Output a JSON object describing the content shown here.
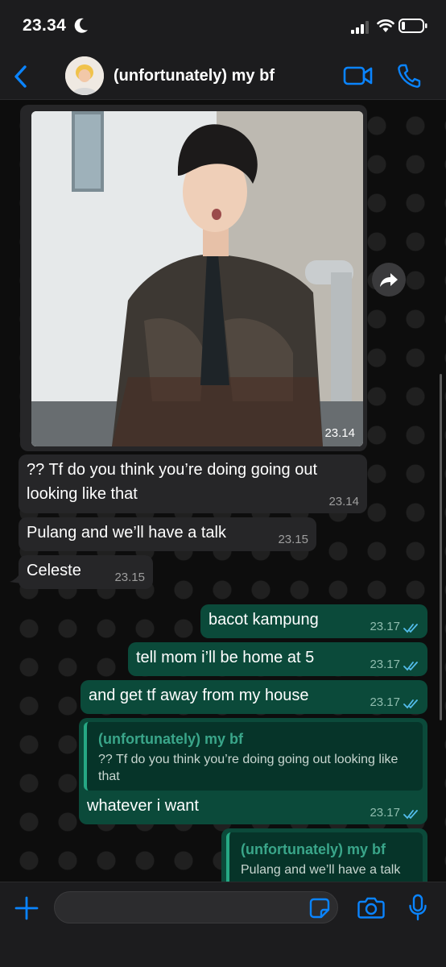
{
  "status_bar": {
    "time": "23.34"
  },
  "header": {
    "contact_name": "(unfortunately) my bf"
  },
  "colors": {
    "accent": "#0a84ff",
    "outgoing_bubble": "#0b4a3a",
    "incoming_bubble": "#262628",
    "quote_name": "#3aa68a",
    "read_ticks": "#53bdeb"
  },
  "image_message": {
    "time": "23.14"
  },
  "messages": [
    {
      "direction": "incoming",
      "text": "?? Tf do you think you’re doing going out looking like that",
      "time": "23.14"
    },
    {
      "direction": "incoming",
      "text": "Pulang and we’ll have a talk",
      "time": "23.15"
    },
    {
      "direction": "incoming",
      "text": "Celeste",
      "time": "23.15"
    },
    {
      "direction": "outgoing",
      "text": "bacot kampung",
      "time": "23.17",
      "status": "read"
    },
    {
      "direction": "outgoing",
      "text": "tell mom i’ll be home at 5",
      "time": "23.17",
      "status": "read"
    },
    {
      "direction": "outgoing",
      "text": "and get tf away from my house",
      "time": "23.17",
      "status": "read"
    },
    {
      "direction": "outgoing",
      "text": "whatever i want",
      "time": "23.17",
      "status": "read",
      "reply_to": {
        "name": "(unfortunately) my bf",
        "text": "?? Tf do you think you’re doing going out looking like that"
      }
    },
    {
      "direction": "outgoing",
      "text": "",
      "reply_to": {
        "name": "(unfortunately) my bf",
        "text": "Pulang and we’ll have a talk"
      }
    }
  ],
  "input": {
    "placeholder": "",
    "value": ""
  },
  "icons": [
    "back-icon",
    "video-call-icon",
    "phone-icon",
    "forward-icon",
    "plus-icon",
    "sticker-icon",
    "camera-icon",
    "microphone-icon",
    "moon-icon",
    "signal-icon",
    "wifi-icon",
    "battery-icon",
    "read-ticks-icon"
  ]
}
